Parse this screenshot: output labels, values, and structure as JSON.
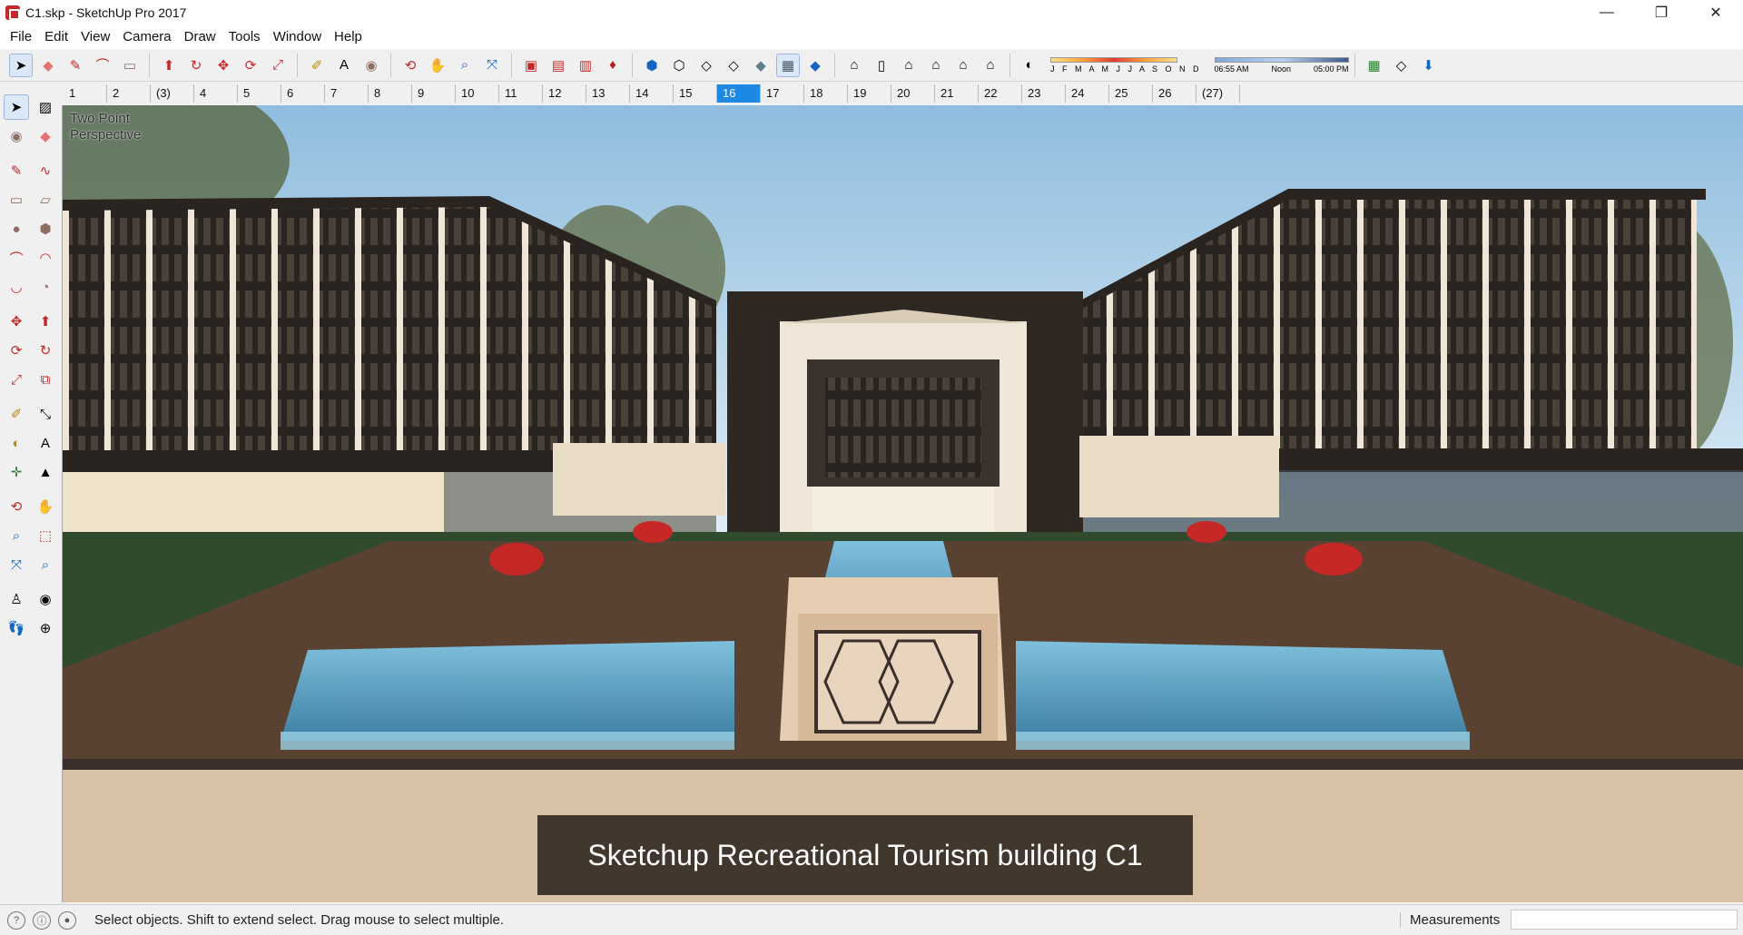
{
  "window": {
    "title": "C1.skp - SketchUp Pro 2017",
    "minimize": "—",
    "restore": "❐",
    "close": "✕"
  },
  "menu": [
    "File",
    "Edit",
    "View",
    "Camera",
    "Draw",
    "Tools",
    "Window",
    "Help"
  ],
  "shadow": {
    "months": "J F M A M J J A S O N D",
    "time_start": "06:55 AM",
    "time_mid": "Noon",
    "time_end": "05:00 PM"
  },
  "scenes": [
    "1",
    "2",
    "(3)",
    "4",
    "5",
    "6",
    "7",
    "8",
    "9",
    "10",
    "11",
    "12",
    "13",
    "14",
    "15",
    "16",
    "17",
    "18",
    "19",
    "20",
    "21",
    "22",
    "23",
    "24",
    "25",
    "26",
    "(27)"
  ],
  "active_scene": "16",
  "viewport": {
    "camera_label_1": "Two Point",
    "camera_label_2": "Perspective",
    "caption": "Sketchup Recreational Tourism building C1"
  },
  "status": {
    "hint": "Select objects. Shift to extend select. Drag mouse to select multiple.",
    "measurements_label": "Measurements",
    "measurements_value": ""
  },
  "colors": {
    "accent": "#1e88e5",
    "sky": "#cfe6f6",
    "water": "#5fa6c9",
    "stone": "#e6ccb0",
    "building_dark": "#3a2f2a"
  }
}
